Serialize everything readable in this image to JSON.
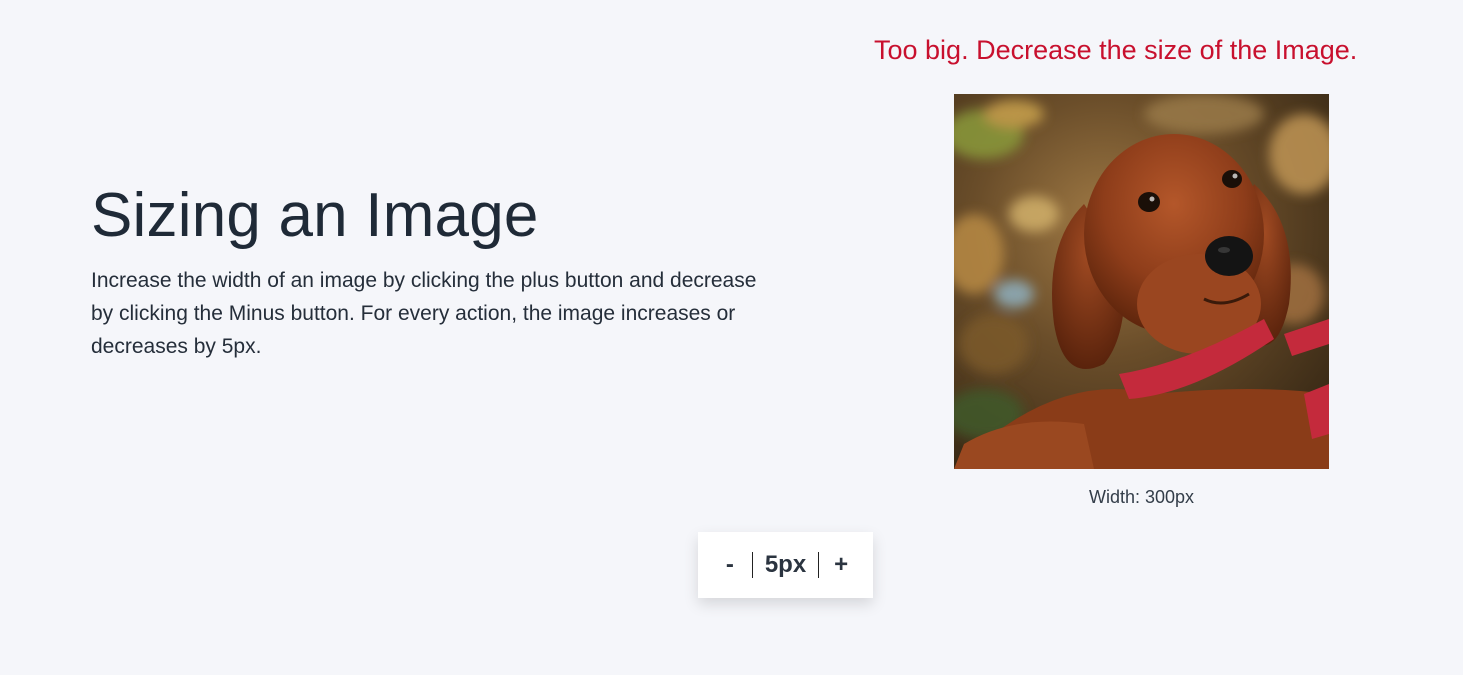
{
  "warning": "Too big. Decrease the size of the Image.",
  "heading": "Sizing an Image",
  "description": "Increase the width of an image by clicking the plus button and decrease by clicking the Minus button. For every action, the image increases or decreases by 5px.",
  "image": {
    "alt": "Brown puppy with red collar lying on autumn leaves",
    "width_label": "Width: 300px"
  },
  "controls": {
    "minus_label": "-",
    "step_label": "5px",
    "plus_label": "+"
  },
  "colors": {
    "background": "#f5f6fa",
    "warning": "#c8102e",
    "text": "#1f2a37"
  }
}
